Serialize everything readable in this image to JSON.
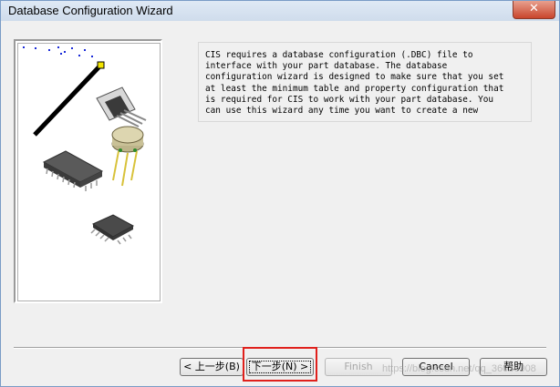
{
  "window": {
    "title": "Database Configuration Wizard",
    "close_label": "✕"
  },
  "description": "CIS requires a database configuration (.DBC) file to\ninterface with your part database. The database\nconfiguration wizard is designed to make sure that you set\nat least the minimum table and property configuration that\nis required for CIS to work with your part database. You\ncan use this wizard any time you want to create a new\n",
  "buttons": {
    "back": "< 上一步(B)",
    "next": "下一步(N) >",
    "finish": "Finish",
    "cancel": "Cancel",
    "help": "帮助"
  },
  "watermark": "https://blog.csdn.net/qq_36036908",
  "colors": {
    "highlight": "#e0201c",
    "title_bar": "#dfe9f5"
  },
  "icons": [
    "close-icon",
    "wand-icon",
    "transistor-icon",
    "to-can-icon",
    "dip-ic-icon",
    "soic-icon"
  ]
}
